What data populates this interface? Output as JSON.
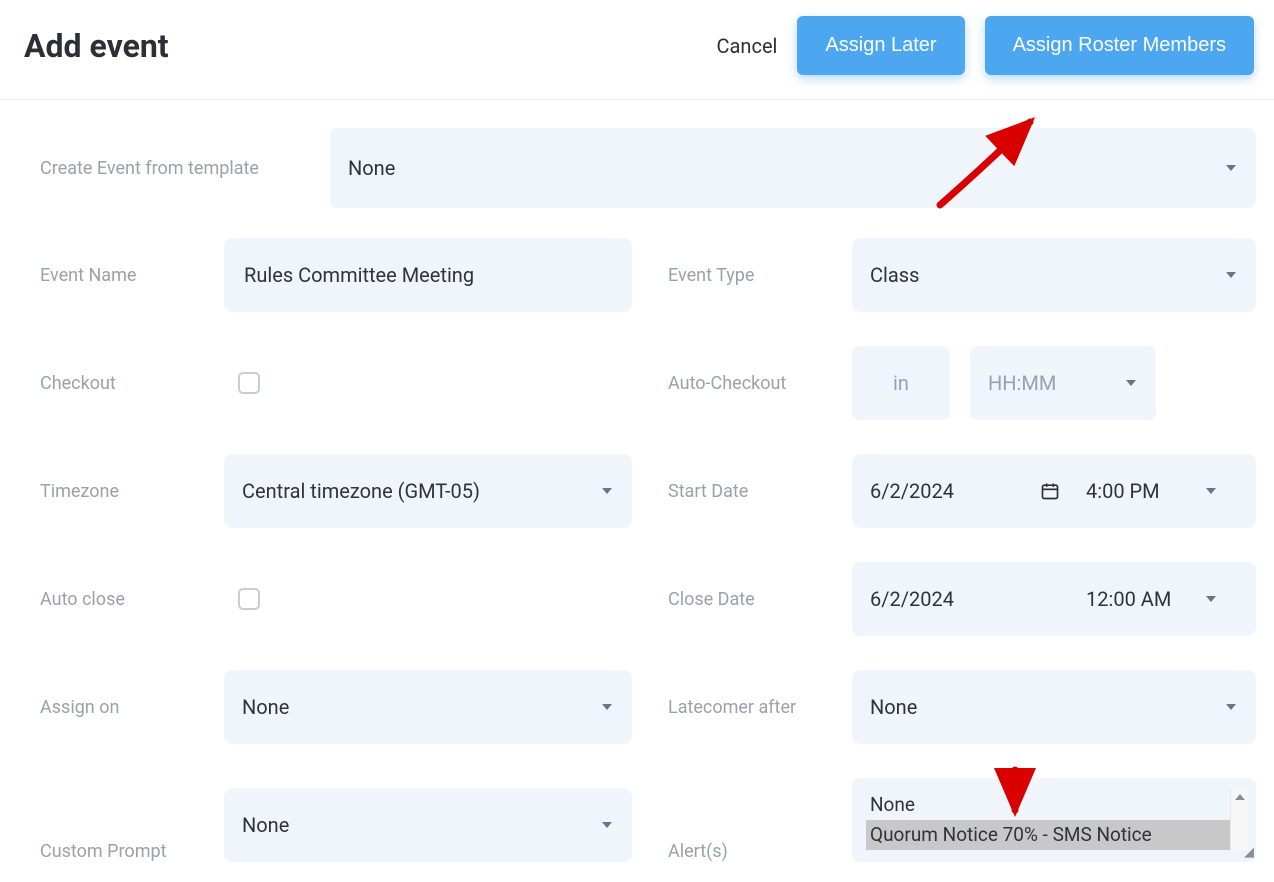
{
  "header": {
    "title": "Add event",
    "cancel_label": "Cancel",
    "assign_later_label": "Assign Later",
    "assign_roster_label": "Assign Roster Members"
  },
  "labels": {
    "create_from_template": "Create Event from template",
    "event_name": "Event Name",
    "event_type": "Event Type",
    "checkout": "Checkout",
    "auto_checkout": "Auto-Checkout",
    "timezone": "Timezone",
    "start_date": "Start Date",
    "auto_close": "Auto close",
    "close_date": "Close Date",
    "assign_on": "Assign on",
    "latecomer_after": "Latecomer after",
    "custom_prompt": "Custom Prompt",
    "alerts": "Alert(s)"
  },
  "values": {
    "template": "None",
    "event_name": "Rules Committee Meeting",
    "event_type": "Class",
    "auto_checkout_in": "in",
    "auto_checkout_placeholder": "HH:MM",
    "timezone": "Central timezone (GMT-05)",
    "start_date": "6/2/2024",
    "start_time": "4:00 PM",
    "close_date": "6/2/2024",
    "close_time": "12:00 AM",
    "assign_on": "None",
    "latecomer_after": "None",
    "custom_prompt": "None",
    "alert_option_1": "None",
    "alert_option_2": "Quorum Notice 70% - SMS Notice"
  }
}
